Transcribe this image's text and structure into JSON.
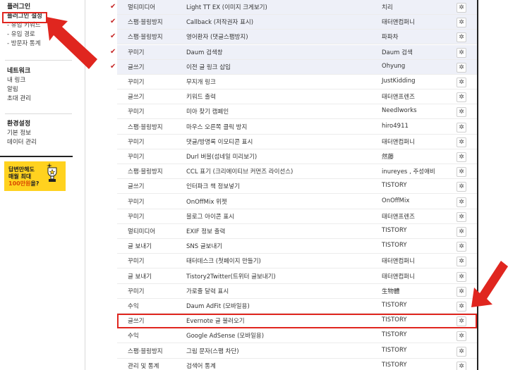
{
  "sidebar": {
    "plugin_title": "플러그인",
    "plugin_settings": "플러그인 설정",
    "plugin_sub": [
      "- 유입 키워드",
      "- 유입 경로",
      "- 방문자 통계"
    ],
    "network_title": "네트워크",
    "network_items": [
      "내 링크",
      "알림",
      "초대 관리"
    ],
    "env_title": "환경설정",
    "env_items": [
      "기본 정보",
      "데이터 관리"
    ],
    "banner": {
      "line1": "답변만해도",
      "line2": "매월 최대",
      "line3_highlight": "100만원",
      "line3_rest": "을?"
    }
  },
  "plugins": [
    {
      "checked": true,
      "category": "멀티미디어",
      "name": "Light TT EX (이미지 크게보기)",
      "author": "치리"
    },
    {
      "checked": true,
      "category": "스팸·블링방지",
      "name": "Callback (저작권자 표시)",
      "author": "태터앤컴퍼니"
    },
    {
      "checked": true,
      "category": "스팸·블링방지",
      "name": "영어환자 (댓글스팸방지)",
      "author": "파파차"
    },
    {
      "checked": true,
      "category": "꾸미기",
      "name": "Daum 검색창",
      "author": "Daum 검색"
    },
    {
      "checked": true,
      "category": "글쓰기",
      "name": "이전 글 링크 삽입",
      "author": "Ohyung"
    },
    {
      "checked": false,
      "category": "꾸미기",
      "name": "무지개 링크",
      "author": "JustKidding"
    },
    {
      "checked": false,
      "category": "글쓰기",
      "name": "키워드 출력",
      "author": "태터앤프렌즈"
    },
    {
      "checked": false,
      "category": "꾸미기",
      "name": "미아 찾기 캠페인",
      "author": "Needlworks"
    },
    {
      "checked": false,
      "category": "스팸·블링방지",
      "name": "마우스 오른쪽 클릭 방지",
      "author": "hiro4911"
    },
    {
      "checked": false,
      "category": "꾸미기",
      "name": "댓글/방명록 이모티콘 표시",
      "author": "태터앤컴퍼니"
    },
    {
      "checked": false,
      "category": "꾸미기",
      "name": "Durl 버블(섬네일 미리보기)",
      "author": "然藤"
    },
    {
      "checked": false,
      "category": "스팸·블링방지",
      "name": "CCL 표기 (크리에이티브 커먼즈 라이선스)",
      "author": "inureyes , 주성애비"
    },
    {
      "checked": false,
      "category": "글쓰기",
      "name": "인터파크 책 정보넣기",
      "author": "TISTORY"
    },
    {
      "checked": false,
      "category": "꾸미기",
      "name": "OnOffMix 위젯",
      "author": "OnOffMix"
    },
    {
      "checked": false,
      "category": "꾸미기",
      "name": "블로그 아이콘 표시",
      "author": "태터앤프렌즈"
    },
    {
      "checked": false,
      "category": "멀티미디어",
      "name": "EXIF 정보 출력",
      "author": "TISTORY"
    },
    {
      "checked": false,
      "category": "글 보내기",
      "name": "SNS 글보내기",
      "author": "TISTORY"
    },
    {
      "checked": false,
      "category": "꾸미기",
      "name": "태터데스크 (첫페이지 만들기)",
      "author": "태터앤컴퍼니"
    },
    {
      "checked": false,
      "category": "글 보내기",
      "name": "Tistory2Twitter(트위터 글보내기)",
      "author": "태터앤컴퍼니"
    },
    {
      "checked": false,
      "category": "꾸미기",
      "name": "가로줄 달력 표시",
      "author": "生物體"
    },
    {
      "checked": false,
      "category": "수익",
      "name": "Daum AdFit (모바일용)",
      "author": "TISTORY"
    },
    {
      "checked": false,
      "category": "글쓰기",
      "name": "Evernote 글 불러오기",
      "author": "TISTORY",
      "highlight": true
    },
    {
      "checked": false,
      "category": "수익",
      "name": "Google AdSense (모바일용)",
      "author": "TISTORY"
    },
    {
      "checked": false,
      "category": "스팸·블링방지",
      "name": "그림 문자(스팸 차단)",
      "author": "TISTORY"
    },
    {
      "checked": false,
      "category": "관리 및 통계",
      "name": "검색어 통계",
      "author": "TISTORY"
    }
  ],
  "icons": {
    "check": "check-icon",
    "gear": "gear-icon",
    "arrow": "red-arrow-annotation"
  },
  "colors": {
    "highlight": "#e0261f",
    "checked_row_bg": "#eef0f8",
    "banner_bg": "#ffd21f"
  }
}
